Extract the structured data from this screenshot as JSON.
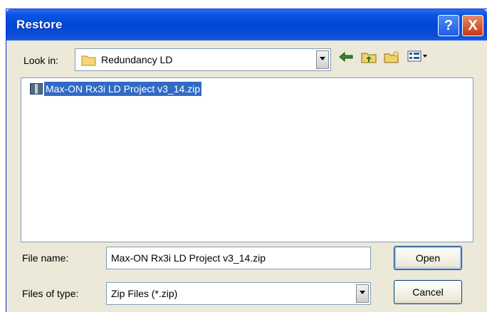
{
  "window": {
    "title": "Restore"
  },
  "titlebar_buttons": {
    "help": "?",
    "close": "X"
  },
  "toolbar": {
    "look_in_label": "Look in:",
    "look_in_value": "Redundancy LD",
    "icons": [
      "back-arrow-icon",
      "up-one-level-icon",
      "create-new-folder-icon",
      "view-menu-icon"
    ]
  },
  "files": [
    {
      "name": "Max-ON Rx3i LD Project v3_14.zip",
      "icon": "zip-file-icon",
      "selected": true
    }
  ],
  "form": {
    "file_name_label": "File name:",
    "file_name_value": "Max-ON Rx3i LD Project v3_14.zip",
    "file_type_label": "Files of type:",
    "file_type_value": "Zip Files (*.zip)"
  },
  "buttons": {
    "open": "Open",
    "cancel": "Cancel"
  },
  "colors": {
    "title_bar": "#0047d9",
    "selection": "#316ac5",
    "dialog_bg": "#ece9d8"
  }
}
